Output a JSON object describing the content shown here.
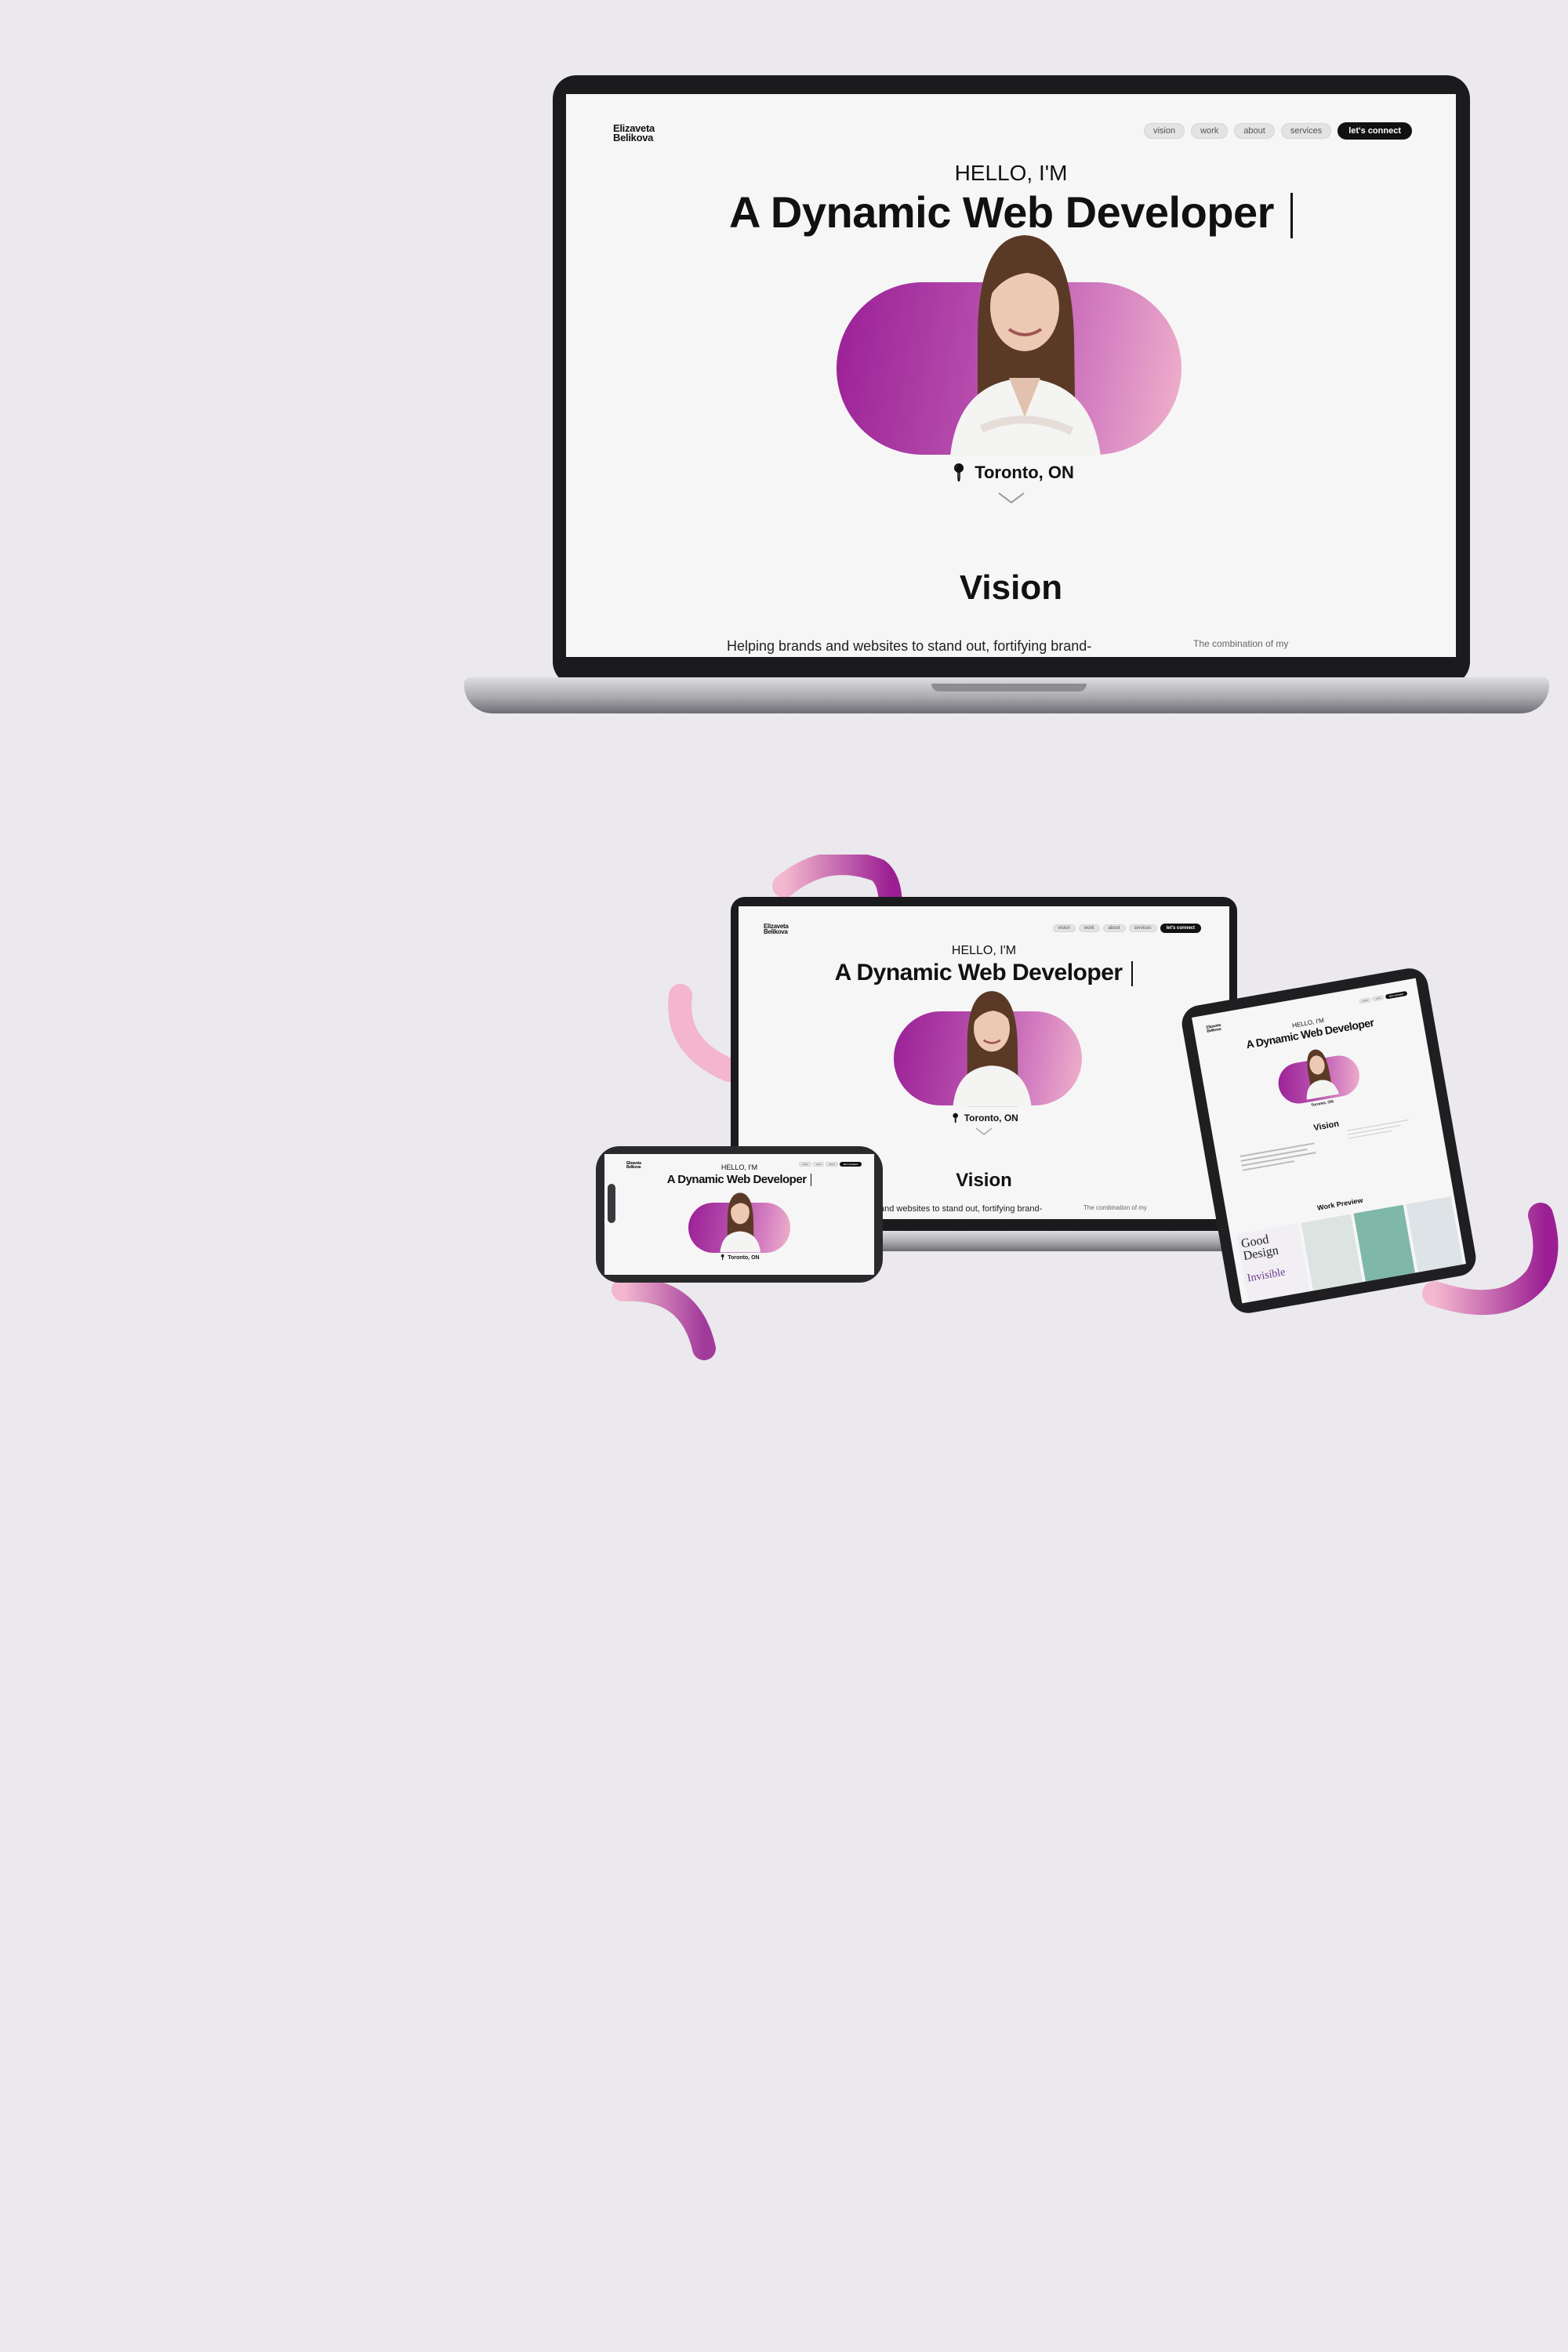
{
  "site": {
    "logo_line1": "Elizaveta",
    "logo_line2": "Belikova",
    "nav": [
      "vision",
      "work",
      "about",
      "services"
    ],
    "cta": "let's connect",
    "hello": "HELLO, I'M",
    "headline": "A Dynamic Web Developer",
    "location": "Toronto, ON",
    "vision_title": "Vision",
    "vision_text": "Helping brands and websites to stand out, fortifying brand-",
    "side_text": "The combination of my",
    "laptop2_vision_text": "and websites to stand out, fortifying brand-",
    "work_preview": "Work Preview",
    "card_text_1": "Good",
    "card_text_2": "Design",
    "card_text_3": "Invisible"
  },
  "colors": {
    "background": "#ebe9ed",
    "accent_purple": "#9a1f96",
    "accent_pink": "#f0b3cb",
    "cta_bg": "#111111"
  }
}
